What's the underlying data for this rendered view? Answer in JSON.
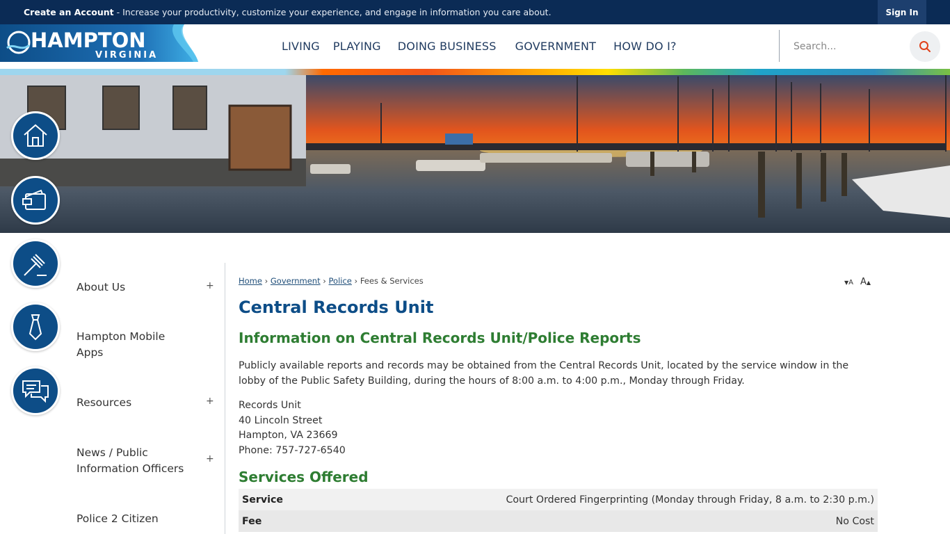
{
  "topbar": {
    "promo_bold": "Create an Account",
    "promo_rest": " - Increase your productivity, customize your experience, and engage in information you care about.",
    "signin_label": "Sign In"
  },
  "header": {
    "logo_line1": "HAMPTON",
    "logo_line2": "VIRGINIA",
    "nav": [
      "LIVING",
      "PLAYING",
      "DOING BUSINESS",
      "GOVERNMENT",
      "HOW DO I?"
    ],
    "search_placeholder": "Search..."
  },
  "quick_icons": [
    "home-icon",
    "wallet-icon",
    "gavel-icon",
    "necktie-icon",
    "chat-bubbles-icon"
  ],
  "sidebar": {
    "items": [
      {
        "label": "About Us",
        "expandable": true
      },
      {
        "label": "Hampton Mobile Apps",
        "expandable": false
      },
      {
        "label": "Resources",
        "expandable": true
      },
      {
        "label": "News / Public Information Officers",
        "expandable": true
      },
      {
        "label": "Police 2 Citizen",
        "expandable": false
      }
    ],
    "plus": "+"
  },
  "breadcrumb": {
    "home": "Home",
    "government": "Government",
    "police": "Police",
    "current": "Fees & Services",
    "sep": "›"
  },
  "fontsize": {
    "decrease": "A",
    "increase": "A"
  },
  "main": {
    "title": "Central Records Unit",
    "subtitle": "Information on Central Records Unit/Police Reports",
    "paragraph": "Publicly available reports and records may be obtained from the Central Records Unit, located by the service window in the lobby of the Public Safety Building, during the hours of 8:00 a.m. to 4:00 p.m., Monday through Friday.",
    "address": {
      "line1": "Records Unit",
      "line2": "40 Lincoln Street",
      "line3": "Hampton, VA 23669",
      "line4": "Phone: 757-727-6540"
    },
    "services_title": "Services Offered",
    "services": [
      {
        "key": "Service",
        "value": "Court Ordered Fingerprinting (Monday through Friday, 8 a.m. to 2:30 p.m.)"
      },
      {
        "key": "Fee",
        "value": "No Cost"
      }
    ]
  },
  "colors": {
    "topbar": "#0b2b55",
    "brand_blue": "#0d4d87",
    "heading_green": "#2e7d32"
  }
}
